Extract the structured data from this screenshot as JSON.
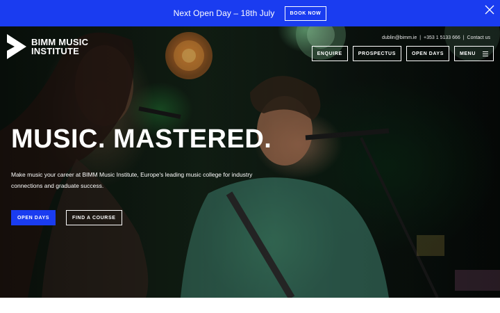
{
  "announcement": {
    "text": "Next Open Day – 18th July",
    "button_label": "BOOK NOW",
    "close_icon": "close-icon"
  },
  "brand": {
    "line1": "BIMM MUSIC",
    "line2": "INSTITUTE",
    "logo_icon": "bimm-logo-icon"
  },
  "contact": {
    "email": "dublin@bimm.ie",
    "separator": "|",
    "phone": "+353 1 5133 666",
    "link": "Contact us"
  },
  "nav": {
    "enquire": "ENQUIRE",
    "prospectus": "PROSPECTUS",
    "open_days": "OPEN DAYS",
    "menu": "MENU",
    "menu_icon": "hamburger-icon"
  },
  "hero": {
    "headline": "MUSIC. MASTERED.",
    "description": "Make music your career at BIMM Music Institute, Europe's leading music college for industry connections and graduate success.",
    "cta_primary": "OPEN DAYS",
    "cta_secondary": "FIND A COURSE"
  },
  "colors": {
    "brand_blue": "#1a3cf0",
    "text_white": "#ffffff"
  }
}
